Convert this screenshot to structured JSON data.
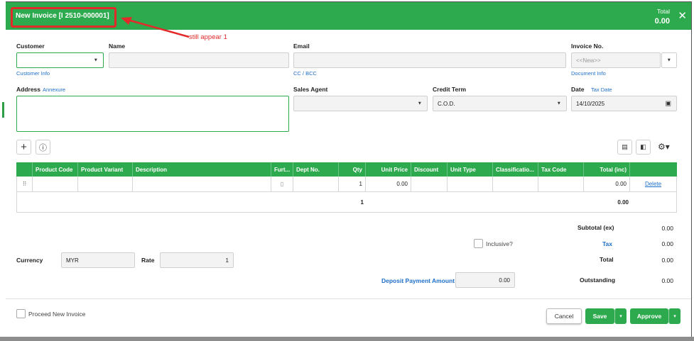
{
  "header": {
    "title": "New Invoice [I 2510-000001]",
    "total_label": "Total",
    "total_value": "0.00"
  },
  "annotation": {
    "text": "still appear 1",
    "color": "#e32a2a"
  },
  "form": {
    "customer_label": "Customer",
    "customer_info_link": "Customer Info",
    "name_label": "Name",
    "email_label": "Email",
    "cc_bcc_link": "CC / BCC",
    "invoice_no_label": "Invoice No.",
    "invoice_no_placeholder": "<<New>>",
    "document_info_link": "Document Info",
    "address_label": "Address",
    "annexure_link": "Annexure",
    "sales_agent_label": "Sales Agent",
    "credit_term_label": "Credit Term",
    "credit_term_value": "C.O.D.",
    "date_label": "Date",
    "tax_date_link": "Tax Date",
    "date_value": "14/10/2025"
  },
  "toolbar": {
    "add_icon": "plus-icon",
    "info_icon": "info-icon"
  },
  "grid": {
    "columns": [
      "",
      "Product Code",
      "Product Variant",
      "Description",
      "Furt...",
      "Dept No.",
      "Qty",
      "Unit Price",
      "Discount",
      "Unit Type",
      "Classificatio...",
      "Tax Code",
      "Total (inc)",
      ""
    ],
    "row": {
      "qty": "1",
      "unit_price": "0.00",
      "total": "0.00",
      "delete_label": "Delete"
    },
    "footer": {
      "qty_total": "1",
      "amount_total": "0.00"
    }
  },
  "summary": {
    "subtotal_label": "Subtotal (ex)",
    "subtotal_value": "0.00",
    "inclusive_label": "Inclusive?",
    "tax_label": "Tax",
    "tax_value": "0.00",
    "total_label": "Total",
    "total_value": "0.00",
    "outstanding_label": "Outstanding",
    "outstanding_value": "0.00",
    "currency_label": "Currency",
    "currency_value": "MYR",
    "rate_label": "Rate",
    "rate_value": "1",
    "deposit_label": "Deposit Payment Amount",
    "deposit_value": "0.00"
  },
  "footer": {
    "proceed_label": "Proceed New Invoice",
    "cancel_label": "Cancel",
    "save_label": "Save",
    "approve_label": "Approve"
  },
  "colors": {
    "brand_green": "#2eaa4e",
    "link_blue": "#1e6fc9",
    "annotation_red": "#e32a2a"
  }
}
